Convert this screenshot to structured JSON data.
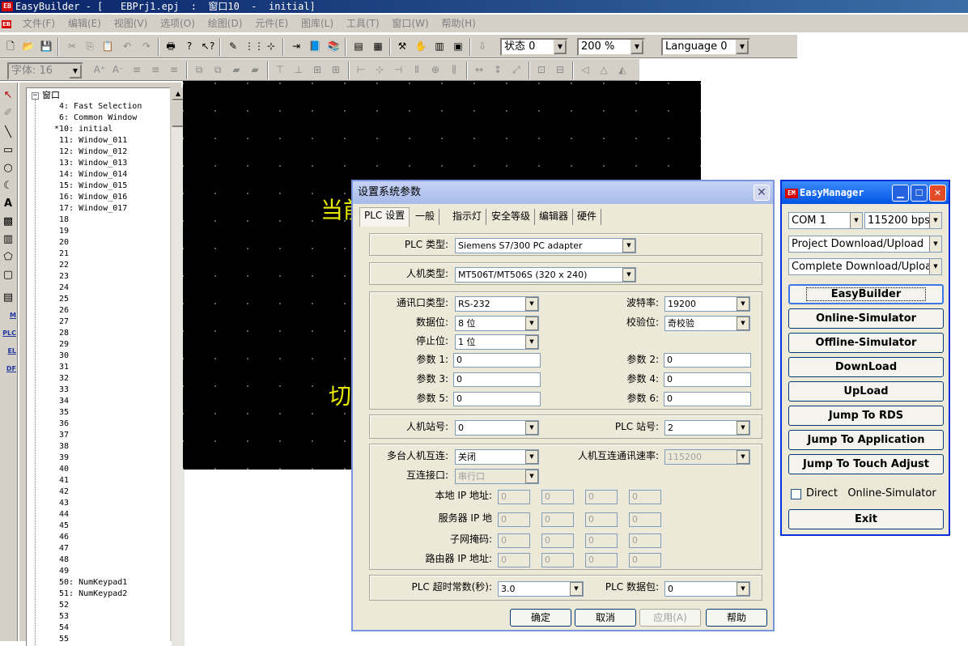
{
  "window": {
    "title": "EasyBuilder - [   EBPrj1.epj  :  窗口10  -  initial]",
    "logo_text": "EB"
  },
  "menu": [
    "文件(F)",
    "编辑(E)",
    "视图(V)",
    "选项(O)",
    "绘图(D)",
    "元件(E)",
    "图库(L)",
    "工具(T)",
    "窗口(W)",
    "帮助(H)"
  ],
  "toolbar1": {
    "state_combo": "状态 0",
    "zoom_combo": "200 %",
    "language_combo": "Language 0"
  },
  "toolbar2": {
    "font_size_combo": "字体: 16"
  },
  "toolcol": {
    "lbl_m": "M",
    "lbl_plc": "PLC",
    "lbl_el": "EL",
    "lbl_df": "DF"
  },
  "tree": {
    "root": "窗口",
    "items": [
      "4: Fast Selection",
      "6: Common Window",
      "*10: initial",
      "11: Window_011",
      "12: Window_012",
      "13: Window_013",
      "14: Window_014",
      "15: Window_015",
      "16: Window_016",
      "17: Window_017",
      "18",
      "19",
      "20",
      "21",
      "22",
      "23",
      "24",
      "25",
      "26",
      "27",
      "28",
      "29",
      "30",
      "31",
      "32",
      "33",
      "34",
      "35",
      "36",
      "37",
      "38",
      "39",
      "40",
      "41",
      "42",
      "43",
      "44",
      "45",
      "46",
      "47",
      "48",
      "49",
      "50: NumKeypad1",
      "51: NumKeypad2",
      "52",
      "53",
      "54",
      "55"
    ]
  },
  "canvas": {
    "text1": "当前",
    "text2": "切"
  },
  "dialog": {
    "title": "设置系统参数",
    "close_glyph": "✕",
    "tabs": [
      "PLC 设置",
      "一般",
      "指示灯",
      "安全等级",
      "编辑器",
      "硬件"
    ],
    "plc_type_label": "PLC 类型:",
    "plc_type_value": "Siemens S7/300 PC adapter",
    "hmi_type_label": "人机类型:",
    "hmi_type_value": "MT506T/MT506S (320 x 240)",
    "port_type_label": "通讯口类型:",
    "port_type_value": "RS-232",
    "baud_label": "波特率:",
    "baud_value": "19200",
    "data_bits_label": "数据位:",
    "data_bits_value": "8 位",
    "parity_label": "校验位:",
    "parity_value": "奇校验",
    "stop_bits_label": "停止位:",
    "stop_bits_value": "1 位",
    "param1_label": "参数 1:",
    "param1_value": "0",
    "param2_label": "参数 2:",
    "param2_value": "0",
    "param3_label": "参数 3:",
    "param3_value": "0",
    "param4_label": "参数 4:",
    "param4_value": "0",
    "param5_label": "参数 5:",
    "param5_value": "0",
    "param6_label": "参数 6:",
    "param6_value": "0",
    "hmi_station_label": "人机站号:",
    "hmi_station_value": "0",
    "plc_station_label": "PLC 站号:",
    "plc_station_value": "2",
    "multi_hmi_label": "多台人机互连:",
    "multi_hmi_value": "关闭",
    "hmi_link_speed_label": "人机互连通讯速率:",
    "hmi_link_speed_value": "115200",
    "link_port_label": "互连接口:",
    "link_port_value": "串行口",
    "local_ip_label": "本地 IP 地址:",
    "server_ip_label": "服务器 IP 地",
    "subnet_label": "子网掩码:",
    "router_ip_label": "路由器 IP 地址:",
    "ip_octet_value": "0",
    "plc_timeout_label": "PLC 超时常数(秒):",
    "plc_timeout_value": "3.0",
    "plc_packet_label": "PLC 数据包:",
    "plc_packet_value": "0",
    "buttons": {
      "ok": "确定",
      "cancel": "取消",
      "apply": "应用(A)",
      "help": "帮助"
    }
  },
  "easymanager": {
    "logo_text": "EM",
    "title": "EasyManager",
    "com_port": "COM 1",
    "baud": "115200 bps",
    "download_mode": "Project Download/Upload",
    "download_scope": "Complete Download/Upload",
    "buttons": [
      "EasyBuilder",
      "Online-Simulator",
      "Offline-Simulator",
      "DownLoad",
      "UpLoad",
      "Jump To RDS",
      "Jump To Application",
      "Jump To Touch Adjust"
    ],
    "direct_checkbox_label": "Direct   Online-Simulator",
    "exit_label": "Exit"
  }
}
